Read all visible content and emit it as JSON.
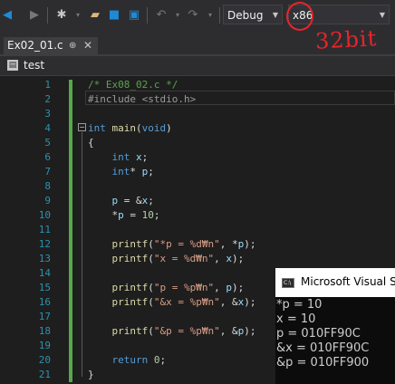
{
  "toolbar": {
    "icons": [
      "back-arrow-icon",
      "forward-arrow-icon",
      "new-project-icon",
      "open-folder-icon",
      "save-icon",
      "save-all-icon",
      "undo-icon",
      "redo-icon"
    ],
    "config_value": "Debug",
    "platform_value": "x86"
  },
  "annotation": {
    "text": "32bit",
    "color": "#e8242b"
  },
  "tab": {
    "title": "Ex02_01.c",
    "pin": "⊕",
    "close": "✕"
  },
  "navbar": {
    "scope": "test"
  },
  "editor": {
    "lines": [
      {
        "n": "1",
        "text": "/* Ex08_02.c */"
      },
      {
        "n": "2",
        "text": "#include <stdio.h>"
      },
      {
        "n": "3",
        "text": ""
      },
      {
        "n": "4",
        "text": "int main(void)"
      },
      {
        "n": "5",
        "text": "{"
      },
      {
        "n": "6",
        "text": "    int x;"
      },
      {
        "n": "7",
        "text": "    int* p;"
      },
      {
        "n": "8",
        "text": ""
      },
      {
        "n": "9",
        "text": "    p = &x;"
      },
      {
        "n": "10",
        "text": "    *p = 10;"
      },
      {
        "n": "11",
        "text": ""
      },
      {
        "n": "12",
        "text": "    printf(\"*p = %d₩n\", *p);"
      },
      {
        "n": "13",
        "text": "    printf(\"x = %d₩n\", x);"
      },
      {
        "n": "14",
        "text": ""
      },
      {
        "n": "15",
        "text": "    printf(\"p = %p₩n\", p);"
      },
      {
        "n": "16",
        "text": "    printf(\"&x = %p₩n\", &x);"
      },
      {
        "n": "17",
        "text": ""
      },
      {
        "n": "18",
        "text": "    printf(\"&p = %p₩n\", &p);"
      },
      {
        "n": "19",
        "text": ""
      },
      {
        "n": "20",
        "text": "    return 0;"
      },
      {
        "n": "21",
        "text": "}"
      }
    ]
  },
  "console": {
    "title": "Microsoft Visual St",
    "output": [
      "*p = 10",
      "x = 10",
      "p = 010FF90C",
      "&x = 010FF90C",
      "&p = 010FF900"
    ]
  },
  "colors": {
    "keyword": "#569cd6",
    "comment": "#57a64a",
    "string": "#d69d85",
    "line_number": "#2b91af"
  }
}
